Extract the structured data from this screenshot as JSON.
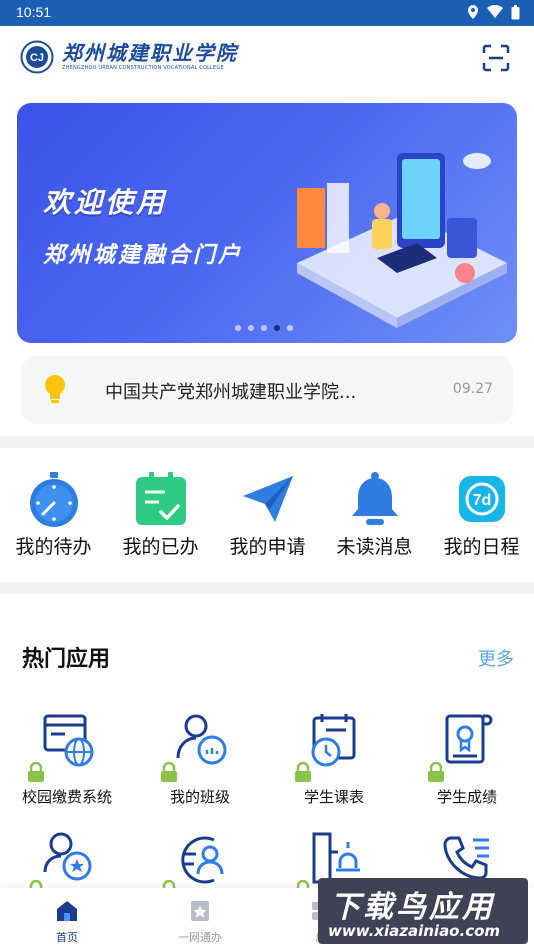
{
  "status": {
    "time": "10:51"
  },
  "header": {
    "logo_cn": "郑州城建职业学院",
    "logo_en": "ZHENGZHOU URBAN CONSTRUCTION VOCATIONAL COLLEGE",
    "logo_emblem": "CJ"
  },
  "banner": {
    "line1": "欢迎使用",
    "line2": "郑州城建融合门户",
    "slide_count": 5,
    "active_slide": 4
  },
  "notice": {
    "text": "中国共产党郑州城建职业学院...",
    "date": "09.27"
  },
  "quick": [
    {
      "label": "我的待办",
      "icon": "stopwatch-icon"
    },
    {
      "label": "我的已办",
      "icon": "done-list-icon"
    },
    {
      "label": "我的申请",
      "icon": "paper-plane-icon"
    },
    {
      "label": "未读消息",
      "icon": "bell-icon"
    },
    {
      "label": "我的日程",
      "icon": "calendar-7d-icon"
    }
  ],
  "hot": {
    "title": "热门应用",
    "more": "更多",
    "apps": [
      {
        "label": "校园缴费系统",
        "icon": "browser-globe-icon"
      },
      {
        "label": "我的班级",
        "icon": "class-group-icon"
      },
      {
        "label": "学生课表",
        "icon": "schedule-clock-icon"
      },
      {
        "label": "学生成绩",
        "icon": "certificate-icon"
      },
      {
        "label": "",
        "icon": "badge-user-icon"
      },
      {
        "label": "",
        "icon": "user-search-icon"
      },
      {
        "label": "",
        "icon": "building-alarm-icon"
      },
      {
        "label": "",
        "icon": "phone-icon"
      }
    ]
  },
  "nav": [
    {
      "label": "首页",
      "icon": "home-icon",
      "active": true
    },
    {
      "label": "一网通办",
      "icon": "star-bookmark-icon",
      "active": false
    },
    {
      "label": "应",
      "icon": "apps-icon",
      "active": false
    }
  ],
  "watermark": {
    "line1": "下载鸟应用",
    "line2": "www.xiazainiao.com"
  },
  "colors": {
    "primary": "#1a5fb4",
    "icon_blue": "#2f7de1",
    "lock_green": "#8bc34a",
    "more_blue": "#5aa6e0"
  }
}
